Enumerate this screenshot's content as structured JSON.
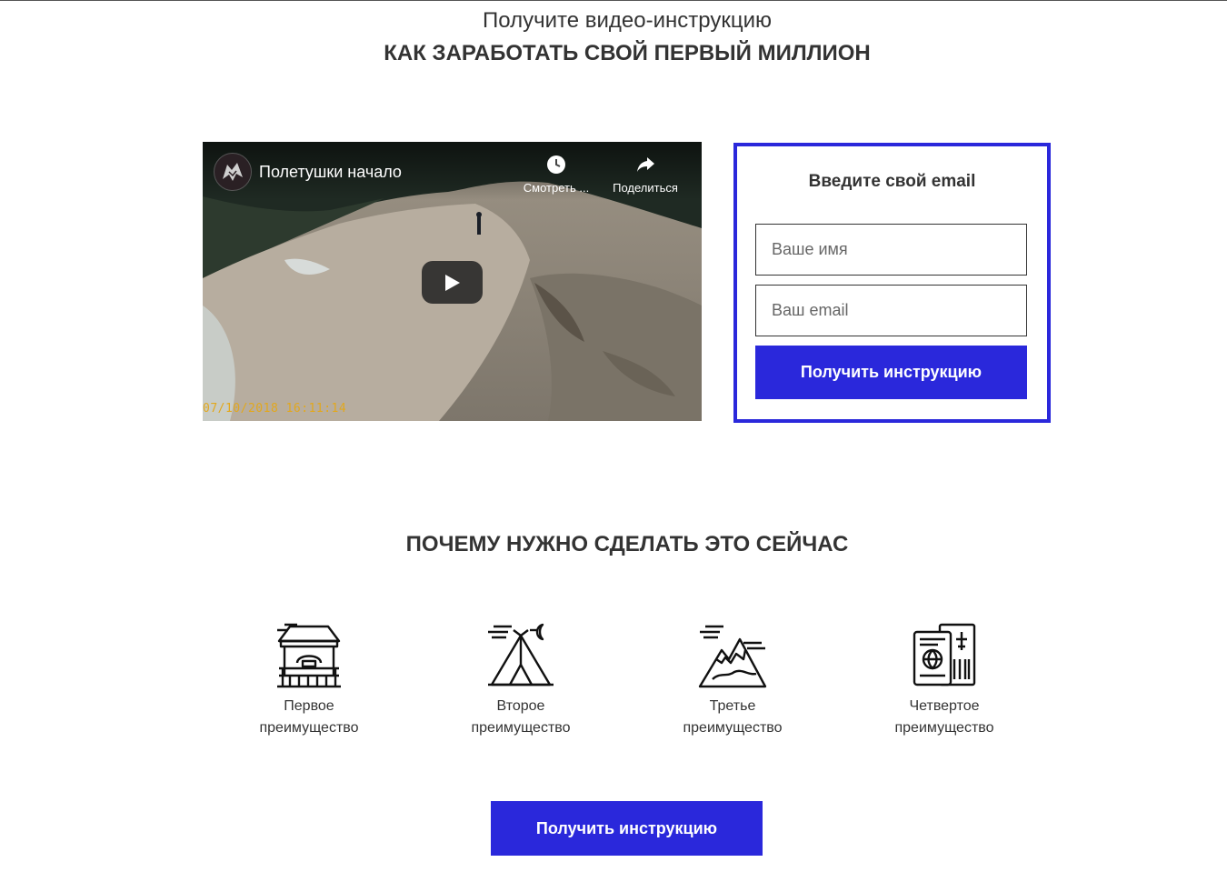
{
  "header": {
    "subtitle": "Получите видео-инструкцию",
    "headline": "КАК ЗАРАБОТАТЬ СВОЙ ПЕРВЫЙ МИЛЛИОН"
  },
  "video": {
    "title": "Полетушки начало",
    "watch_later_label": "Смотреть ...",
    "share_label": "Поделиться",
    "timestamp": "07/10/2018 16:11:14"
  },
  "form": {
    "title": "Введите свой email",
    "name_placeholder": "Ваше имя",
    "name_value": "",
    "email_placeholder": "Ваш email",
    "email_value": "",
    "submit_label": "Получить инструкцию"
  },
  "why": {
    "title": "ПОЧЕМУ НУЖНО СДЕЛАТЬ ЭТО СЕЙЧАС",
    "items": [
      {
        "line1": "Первое",
        "line2": "преимущество",
        "icon": "gazebo-icon"
      },
      {
        "line1": "Второе",
        "line2": "преимущество",
        "icon": "tent-icon"
      },
      {
        "line1": "Третье",
        "line2": "преимущество",
        "icon": "mountain-icon"
      },
      {
        "line1": "Четвертое",
        "line2": "преимущество",
        "icon": "passport-ticket-icon"
      }
    ]
  },
  "cta": {
    "label": "Получить инструкцию"
  },
  "colors": {
    "accent": "#2a28db",
    "text": "#333333",
    "timestamp": "#e2a81d"
  }
}
